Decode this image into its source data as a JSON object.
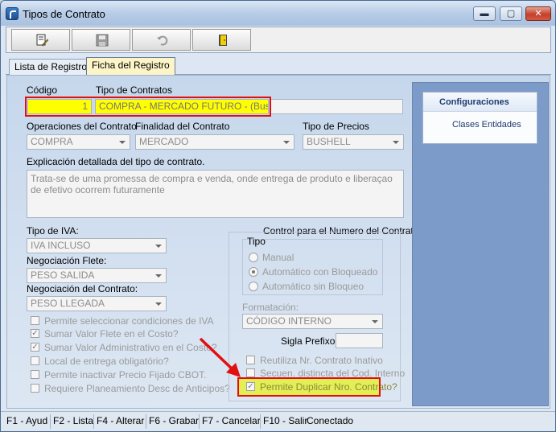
{
  "window": {
    "title": "Tipos de Contrato"
  },
  "tabs": [
    {
      "label": "Lista de Registros"
    },
    {
      "label": "Ficha del Registro"
    }
  ],
  "form": {
    "codigo": {
      "label": "Código",
      "value": "1"
    },
    "tipo_contratos": {
      "label": "Tipo de Contratos",
      "value": "COMPRA - MERCADO FUTURO - (Bushell)"
    },
    "operaciones": {
      "label": "Operaciones del Contrato",
      "value": "COMPRA"
    },
    "finalidad": {
      "label": "Finalidad del Contrato",
      "value": "MERCADO"
    },
    "tipo_precios": {
      "label": "Tipo de Precios",
      "value": "BUSHELL"
    },
    "explicacion": {
      "label": "Explicación detallada del tipo de contrato.",
      "value": "Trata-se de uma promessa de compra e venda, onde entrega de produto e liberaçao de efetivo ocorrem futuramente"
    },
    "tipo_iva": {
      "label": "Tipo de IVA:",
      "value": "IVA INCLUSO"
    },
    "negociacion_flete": {
      "label": "Negociación Flete:",
      "value": "PESO SALIDA"
    },
    "negociacion_contrato": {
      "label": "Negociación del Contrato:",
      "value": "PESO LLEGADA"
    },
    "checkboxes": [
      {
        "label": "Permite seleccionar condiciones de IVA",
        "checked": false
      },
      {
        "label": "Sumar Valor Flete en el Costo?",
        "checked": true
      },
      {
        "label": "Sumar Valor Administrativo en el Costo?",
        "checked": true
      },
      {
        "label": "Local de entrega obligatório?",
        "checked": false
      },
      {
        "label": "Permite inactivar Precio Fijado CBOT.",
        "checked": false
      },
      {
        "label": "Requiere Planeamiento Desc de Anticipos?",
        "checked": false
      }
    ]
  },
  "control_numero": {
    "title": "Control para el Numero del Contrato",
    "tipo_label": "Tipo",
    "radios": [
      {
        "label": "Manual",
        "selected": false
      },
      {
        "label": "Automático con Bloqueado",
        "selected": true
      },
      {
        "label": "Automático sin Bloqueo",
        "selected": false
      }
    ],
    "formatacion_label": "Formatación:",
    "formatacion_value": "CÓDIGO INTERNO",
    "sigla_label": "Sigla Prefixo:",
    "sigla_value": "",
    "checkboxes": [
      {
        "label": "Reutiliza Nr. Contrato Inativo",
        "checked": false
      },
      {
        "label": "Secuen. distincta del Cod. Interno",
        "checked": false
      },
      {
        "label": "Permite Duplicar Nro. Contrato?",
        "checked": true
      }
    ]
  },
  "side_panel": {
    "header": "Configuraciones",
    "item": "Clases Entidades"
  },
  "status_bar": [
    "F1 - Ayud",
    "F2 - Lista",
    "F4 - Alterar",
    "F6 - Grabar",
    "F7 - Cancelar",
    "F10 - Salir",
    "Conectado"
  ],
  "colors": {
    "highlight": "#ffff00",
    "annotation_red": "#e01010",
    "side_panel": "#7d9bc8"
  }
}
